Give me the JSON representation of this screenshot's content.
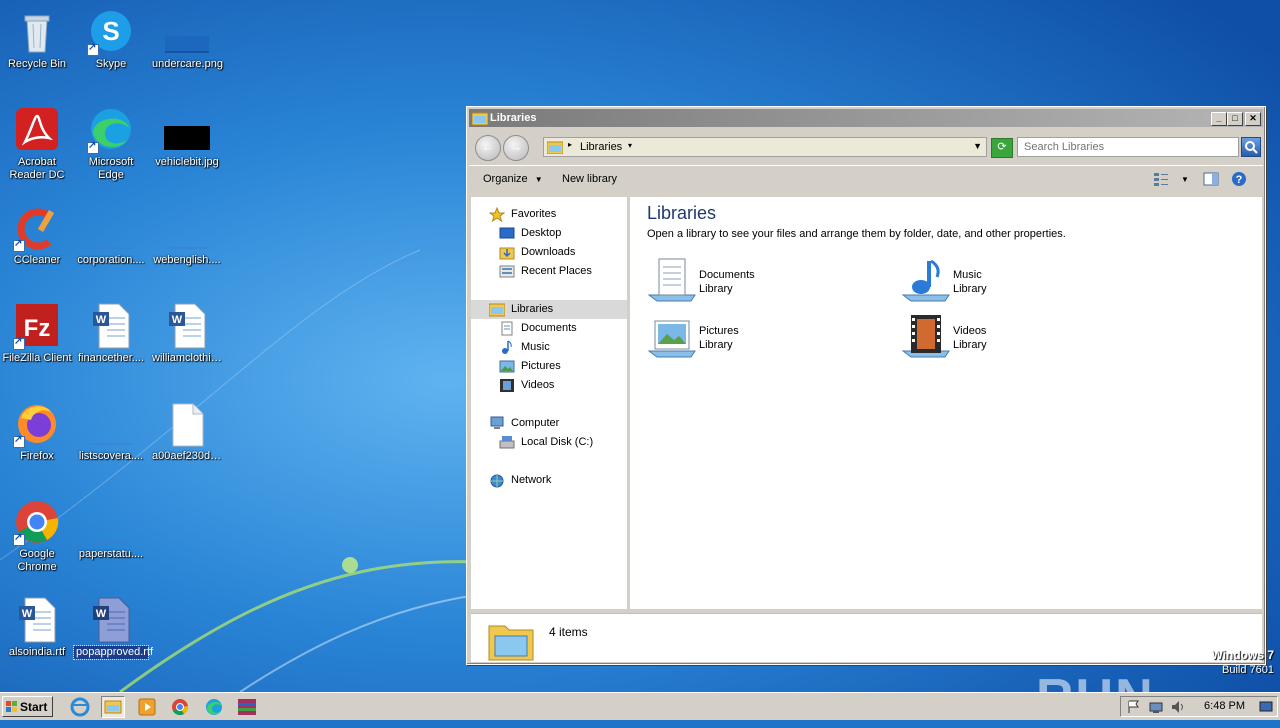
{
  "desktop": {
    "icons": [
      {
        "label": "Recycle Bin",
        "icon": "recycle-bin-icon"
      },
      {
        "label": "Skype",
        "icon": "skype-icon"
      },
      {
        "label": "undercare.png",
        "icon": "image-file-icon"
      },
      {
        "label": "Acrobat Reader DC",
        "icon": "acrobat-icon"
      },
      {
        "label": "Microsoft Edge",
        "icon": "edge-icon"
      },
      {
        "label": "vehiclebit.jpg",
        "icon": "image-file-icon"
      },
      {
        "label": "CCleaner",
        "icon": "ccleaner-icon"
      },
      {
        "label": "corporation....",
        "icon": "file-icon"
      },
      {
        "label": "webenglish....",
        "icon": "file-icon"
      },
      {
        "label": "FileZilla Client",
        "icon": "filezilla-icon"
      },
      {
        "label": "financether....",
        "icon": "word-doc-icon"
      },
      {
        "label": "williamclothi....",
        "icon": "word-doc-icon"
      },
      {
        "label": "Firefox",
        "icon": "firefox-icon"
      },
      {
        "label": "listscovera....",
        "icon": "file-icon"
      },
      {
        "label": "a00aef230d....",
        "icon": "blank-file-icon"
      },
      {
        "label": "Google Chrome",
        "icon": "chrome-icon"
      },
      {
        "label": "paperstatu....",
        "icon": "file-icon"
      },
      {
        "label": "alsoindia.rtf",
        "icon": "word-doc-icon"
      },
      {
        "label": "popapproved.rtf",
        "icon": "word-doc-icon"
      }
    ]
  },
  "explorer": {
    "title": "Libraries",
    "address": "Libraries",
    "search_placeholder": "Search Libraries",
    "commands": {
      "organize": "Organize",
      "new_library": "New library"
    },
    "nav": {
      "favorites": "Favorites",
      "desktop": "Desktop",
      "downloads": "Downloads",
      "recent_places": "Recent Places",
      "libraries": "Libraries",
      "documents": "Documents",
      "music": "Music",
      "pictures": "Pictures",
      "videos": "Videos",
      "computer": "Computer",
      "local_disk": "Local Disk (C:)",
      "network": "Network"
    },
    "content": {
      "heading": "Libraries",
      "description": "Open a library to see your files and arrange them by folder, date, and other properties.",
      "libraries": [
        {
          "name": "Documents",
          "type": "Library"
        },
        {
          "name": "Music",
          "type": "Library"
        },
        {
          "name": "Pictures",
          "type": "Library"
        },
        {
          "name": "Videos",
          "type": "Library"
        }
      ]
    },
    "status": {
      "count": "4 items"
    }
  },
  "watermark": "ANY RUN",
  "windows_brand": {
    "line1": "Windows 7",
    "line2": "Build 7601"
  },
  "taskbar": {
    "start_label": "Start",
    "clock": "6:48 PM"
  },
  "colors": {
    "desktop_blue": "#1f74c9",
    "window_gray": "#d4d0c8",
    "heading_blue": "#1e3a6e"
  }
}
